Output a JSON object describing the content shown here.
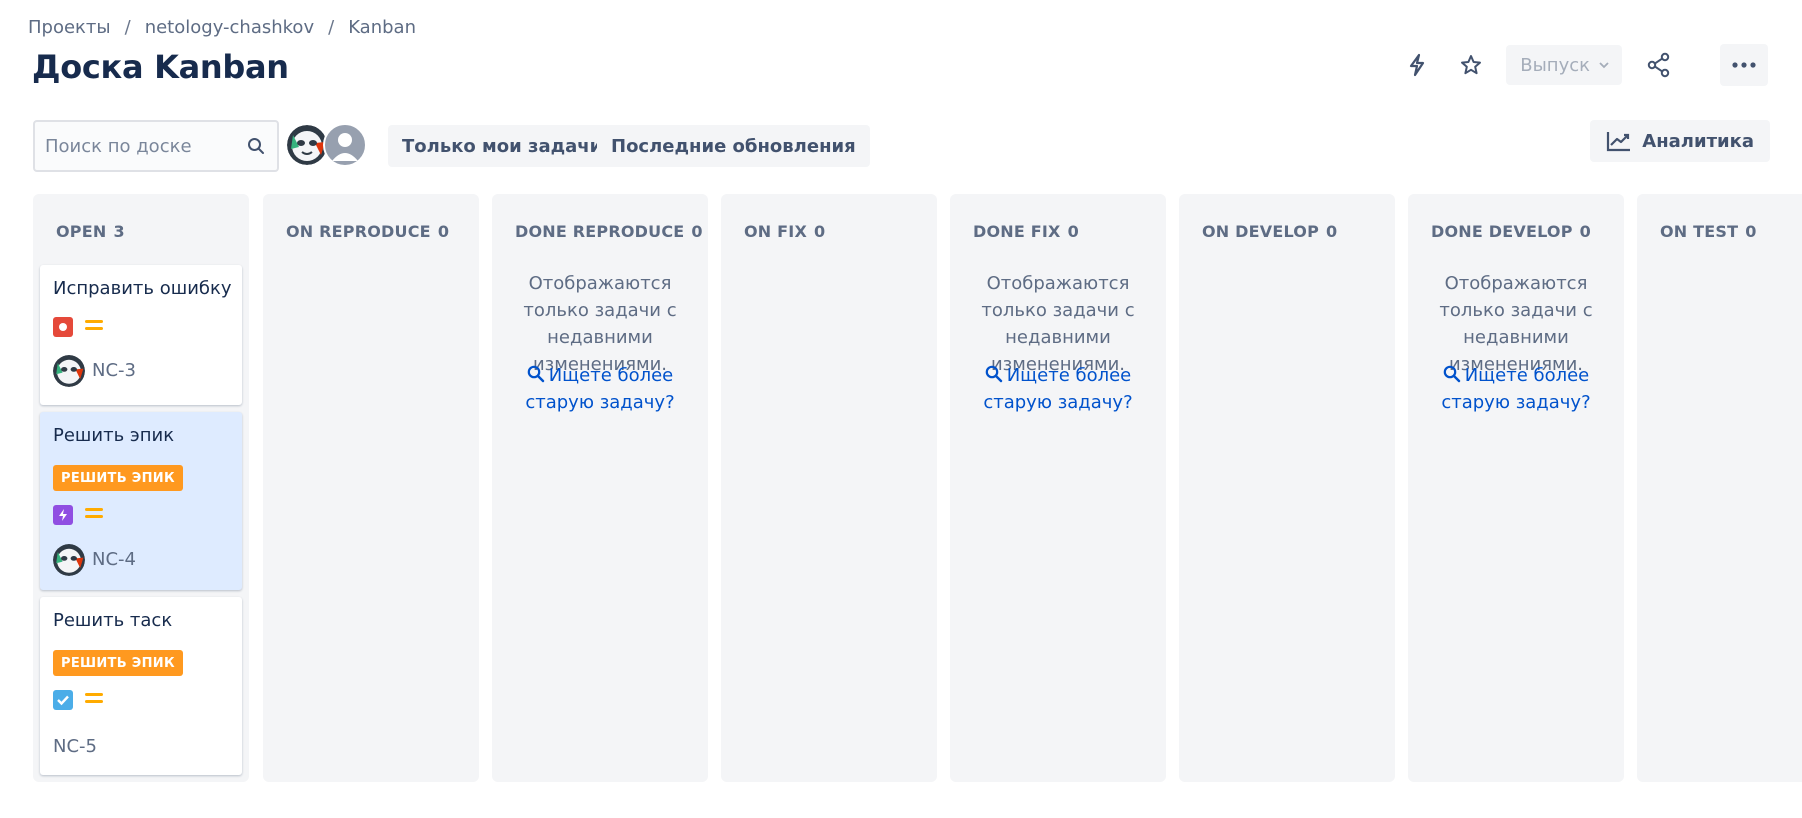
{
  "breadcrumb": [
    "Проекты",
    "netology-chashkov",
    "Kanban"
  ],
  "breadcrumb_sep": "/",
  "title": "Доска Kanban",
  "header": {
    "release_label": "Выпуск"
  },
  "toolbar": {
    "search_placeholder": "Поиск по доске",
    "filter_mine": "Только мои задачи",
    "filter_recent": "Последние обновления",
    "analytics": "Аналитика"
  },
  "board": {
    "empty_note": "Отображаются только задачи с недавними изменениями.",
    "older_link": "Ищете более старую задачу?",
    "columns": [
      {
        "name": "OPEN",
        "count": "3"
      },
      {
        "name": "ON REPRODUCE",
        "count": "0"
      },
      {
        "name": "DONE REPRODUCE",
        "count": "0"
      },
      {
        "name": "ON FIX",
        "count": "0"
      },
      {
        "name": "DONE FIX",
        "count": "0"
      },
      {
        "name": "ON DEVELOP",
        "count": "0"
      },
      {
        "name": "DONE DEVELOP",
        "count": "0"
      },
      {
        "name": "ON TEST",
        "count": "0"
      }
    ],
    "cards": [
      {
        "title": "Исправить ошибку",
        "key": "NC-3",
        "type": "bug",
        "priority": "medium"
      },
      {
        "title": "Решить эпик",
        "epic": "РЕШИТЬ ЭПИК",
        "key": "NC-4",
        "type": "epic",
        "priority": "medium"
      },
      {
        "title": "Решить таск",
        "epic": "РЕШИТЬ ЭПИК",
        "key": "NC-5",
        "type": "task",
        "priority": "medium"
      }
    ]
  },
  "icons": {
    "search": "search-icon",
    "bolt": "lightning-icon",
    "star": "star-icon",
    "share": "share-icon",
    "more": "more-icon",
    "analytics": "chart-line-icon"
  },
  "colors": {
    "accent": "#0052cc",
    "epic_badge": "#ff991f",
    "bug": "#e5493a",
    "epic": "#904ee2",
    "task": "#4bade8",
    "priority_medium": "#ffab00",
    "column_bg": "#f4f5f7",
    "selected_card": "#deebff"
  }
}
